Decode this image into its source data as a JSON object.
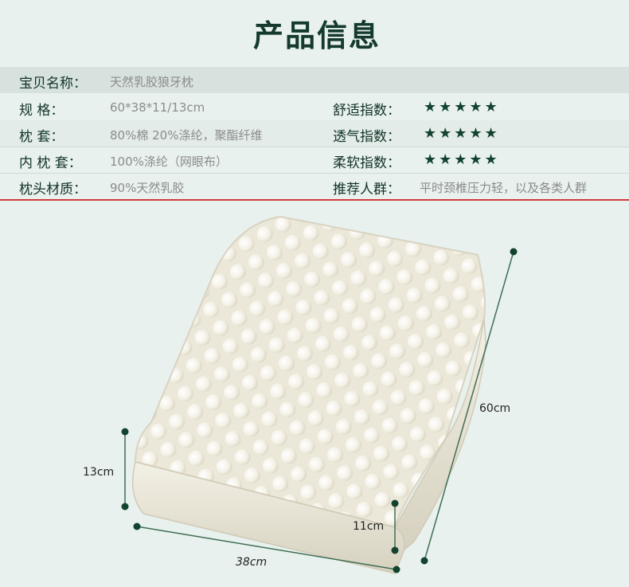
{
  "title": "产品信息",
  "rows": [
    {
      "label": "宝贝名称：",
      "value": "天然乳胶狼牙枕"
    },
    {
      "label": "规      格：",
      "value": "60*38*11/13cm"
    },
    {
      "label": "枕      套：",
      "value": "80%棉 20%涤纶，聚酯纤维"
    },
    {
      "label": "内 枕 套：",
      "value": "100%涤纶（网眼布）"
    },
    {
      "label": "枕头材质：",
      "value": "90%天然乳胶"
    }
  ],
  "ratings": [
    {
      "label": "舒适指数：",
      "stars": "★★★★★"
    },
    {
      "label": "透气指数：",
      "stars": "★★★★★"
    },
    {
      "label": "柔软指数：",
      "stars": "★★★★★"
    }
  ],
  "audience": {
    "label": "推荐人群：",
    "value": "平时颈椎压力轻，以及各类人群"
  },
  "dimensions": {
    "length": "60cm",
    "width": "38cm",
    "height_low": "11cm",
    "height_high": "13cm"
  },
  "colors": {
    "accent": "#12432f",
    "background": "#e8f1ee"
  }
}
